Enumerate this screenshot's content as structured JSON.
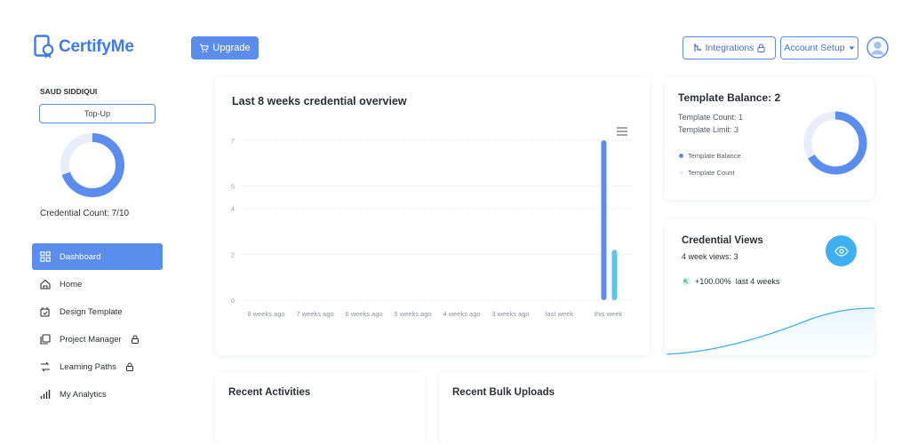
{
  "header": {
    "logo_text": "CertifyMe",
    "upgrade_label": "Upgrade",
    "integrations_label": "Integrations",
    "account_setup_label": "Account Setup"
  },
  "sidebar": {
    "user_name": "SAUD SIDDIQUI",
    "topup_label": "Top-Up",
    "credential_count_text": "Credential Count: 7/10",
    "credential_used": 7,
    "credential_total": 10,
    "items": [
      {
        "label": "Dashboard",
        "icon": "dashboard-icon",
        "active": true,
        "locked": false
      },
      {
        "label": "Home",
        "icon": "home-icon",
        "active": false,
        "locked": false
      },
      {
        "label": "Design Template",
        "icon": "design-template-icon",
        "active": false,
        "locked": false
      },
      {
        "label": "Project Manager",
        "icon": "project-manager-icon",
        "active": false,
        "locked": true
      },
      {
        "label": "Learning Paths",
        "icon": "learning-paths-icon",
        "active": false,
        "locked": true
      },
      {
        "label": "My Analytics",
        "icon": "analytics-icon",
        "active": false,
        "locked": false
      }
    ]
  },
  "overview": {
    "title": "Last 8 weeks credential overview"
  },
  "chart_data": {
    "type": "bar",
    "title": "Last 8 weeks credential overview",
    "categories": [
      "8 weeks ago",
      "7 weeks ago",
      "6 weeks ago",
      "5 weeks ago",
      "4 weeks ago",
      "3 weeks ago",
      "last week",
      "this week"
    ],
    "series": [
      {
        "values": [
          0,
          0,
          0,
          0,
          0,
          0,
          0,
          7
        ],
        "color": "#5b8def"
      },
      {
        "values": [
          0,
          0,
          0,
          0,
          0,
          0,
          0,
          2.2
        ],
        "color": "#5cc4f5"
      }
    ],
    "yticks": [
      0,
      2,
      4,
      5,
      7
    ],
    "ylim": [
      0,
      7
    ],
    "grid": true,
    "xlabel": "",
    "ylabel": ""
  },
  "balance": {
    "title": "Template Balance: 2",
    "count_text": "Template Count: 1",
    "limit_text": "Template Limit: 3",
    "legend": [
      {
        "label": "Template Balance",
        "color": "#5b8def"
      },
      {
        "label": "Template Count",
        "color": "#e8eef9"
      }
    ],
    "balance_value": 2,
    "count_value": 1
  },
  "views": {
    "title": "Credential Views",
    "subtitle": "4 week views: 3",
    "trend_value": "+100.00%",
    "trend_text": "last 4 weeks"
  },
  "recent_activities": {
    "title": "Recent Activities"
  },
  "recent_bulk": {
    "title": "Recent Bulk Uploads"
  },
  "colors": {
    "primary": "#5b8def",
    "accent": "#3eb0f1",
    "light": "#e8eef9"
  }
}
